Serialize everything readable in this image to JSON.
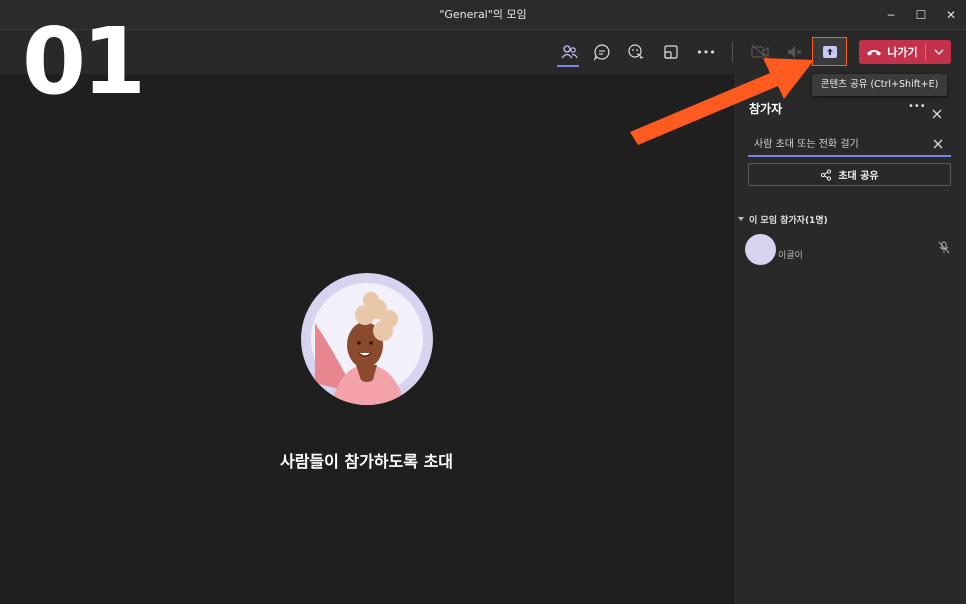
{
  "window": {
    "title": "\"General\"의 모임",
    "minimize_glyph": "─",
    "maximize_glyph": "☐",
    "close_glyph": "✕"
  },
  "overlay": {
    "step_label": "01"
  },
  "toolbar": {
    "participants_icon": "people-icon",
    "chat_icon": "chat-icon",
    "reactions_icon": "reactions-icon",
    "rooms_icon": "rooms-icon",
    "more_label": "•••",
    "share_tooltip": "콘텐츠 공유 (Ctrl+Shift+E)",
    "leave_label": "나가기"
  },
  "panel": {
    "title": "참가자",
    "more_label": "•••",
    "search_placeholder": "사람 초대 또는 전화 걸기",
    "share_invite_label": "초대 공유",
    "section_label": "이 모임 참가자(1명)",
    "participants": [
      {
        "name": "이골이"
      }
    ]
  },
  "stage": {
    "invite_text": "사람들이 참가하도록 초대"
  },
  "colors": {
    "accent": "#7b83eb",
    "leave": "#c4314b",
    "highlight": "#ff5a1f"
  }
}
